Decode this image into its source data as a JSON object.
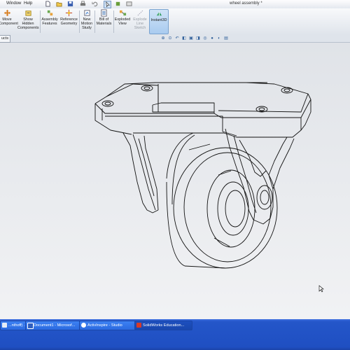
{
  "menubar": {
    "items": [
      {
        "label": "Window"
      },
      {
        "label": "Help"
      }
    ],
    "document_title": "wheel assembly *"
  },
  "ribbon": {
    "buttons": [
      {
        "label": "Move\nComponent",
        "icon": "move-component-icon"
      },
      {
        "label": "Show\nHidden\nComponents",
        "icon": "show-hidden-components-icon"
      },
      {
        "label": "Assembly\nFeatures",
        "icon": "assembly-features-icon"
      },
      {
        "label": "Reference\nGeometry",
        "icon": "reference-geometry-icon"
      },
      {
        "label": "New\nMotion\nStudy",
        "icon": "motion-study-icon"
      },
      {
        "label": "Bill of\nMaterials",
        "icon": "bill-of-materials-icon"
      },
      {
        "label": "Exploded\nView",
        "icon": "exploded-view-icon"
      },
      {
        "label": "Explode\nLine\nSketch",
        "icon": "explode-line-sketch-icon"
      },
      {
        "label": "Instant3D",
        "icon": "instant3d-icon"
      }
    ],
    "colors": {
      "active_bg": "#a9cbef",
      "disabled_text": "#9aa0a8"
    }
  },
  "tabs": {
    "products_label": "ucts"
  },
  "view_toolbar": {
    "icons": [
      "zoom-to-fit-icon",
      "zoom-area-icon",
      "previous-view-icon",
      "section-view-icon",
      "view-orientation-icon",
      "display-style-icon",
      "hide-show-icon",
      "appearance-icon",
      "scene-icon",
      "view-settings-icon"
    ]
  },
  "model": {
    "name": "caster wheel assembly",
    "line_color": "#111111"
  },
  "taskbar": {
    "items": [
      {
        "label": "...nthoff) ...",
        "icon": "window-icon"
      },
      {
        "label": "Document1 - Microsof...",
        "icon": "word-icon"
      },
      {
        "label": "ActivInspire - Studio",
        "icon": "activinspire-icon"
      },
      {
        "label": "SolidWorks Education...",
        "icon": "solidworks-icon"
      }
    ],
    "colors": {
      "bar": "#2456c9",
      "button": "#2b6ae0"
    }
  }
}
